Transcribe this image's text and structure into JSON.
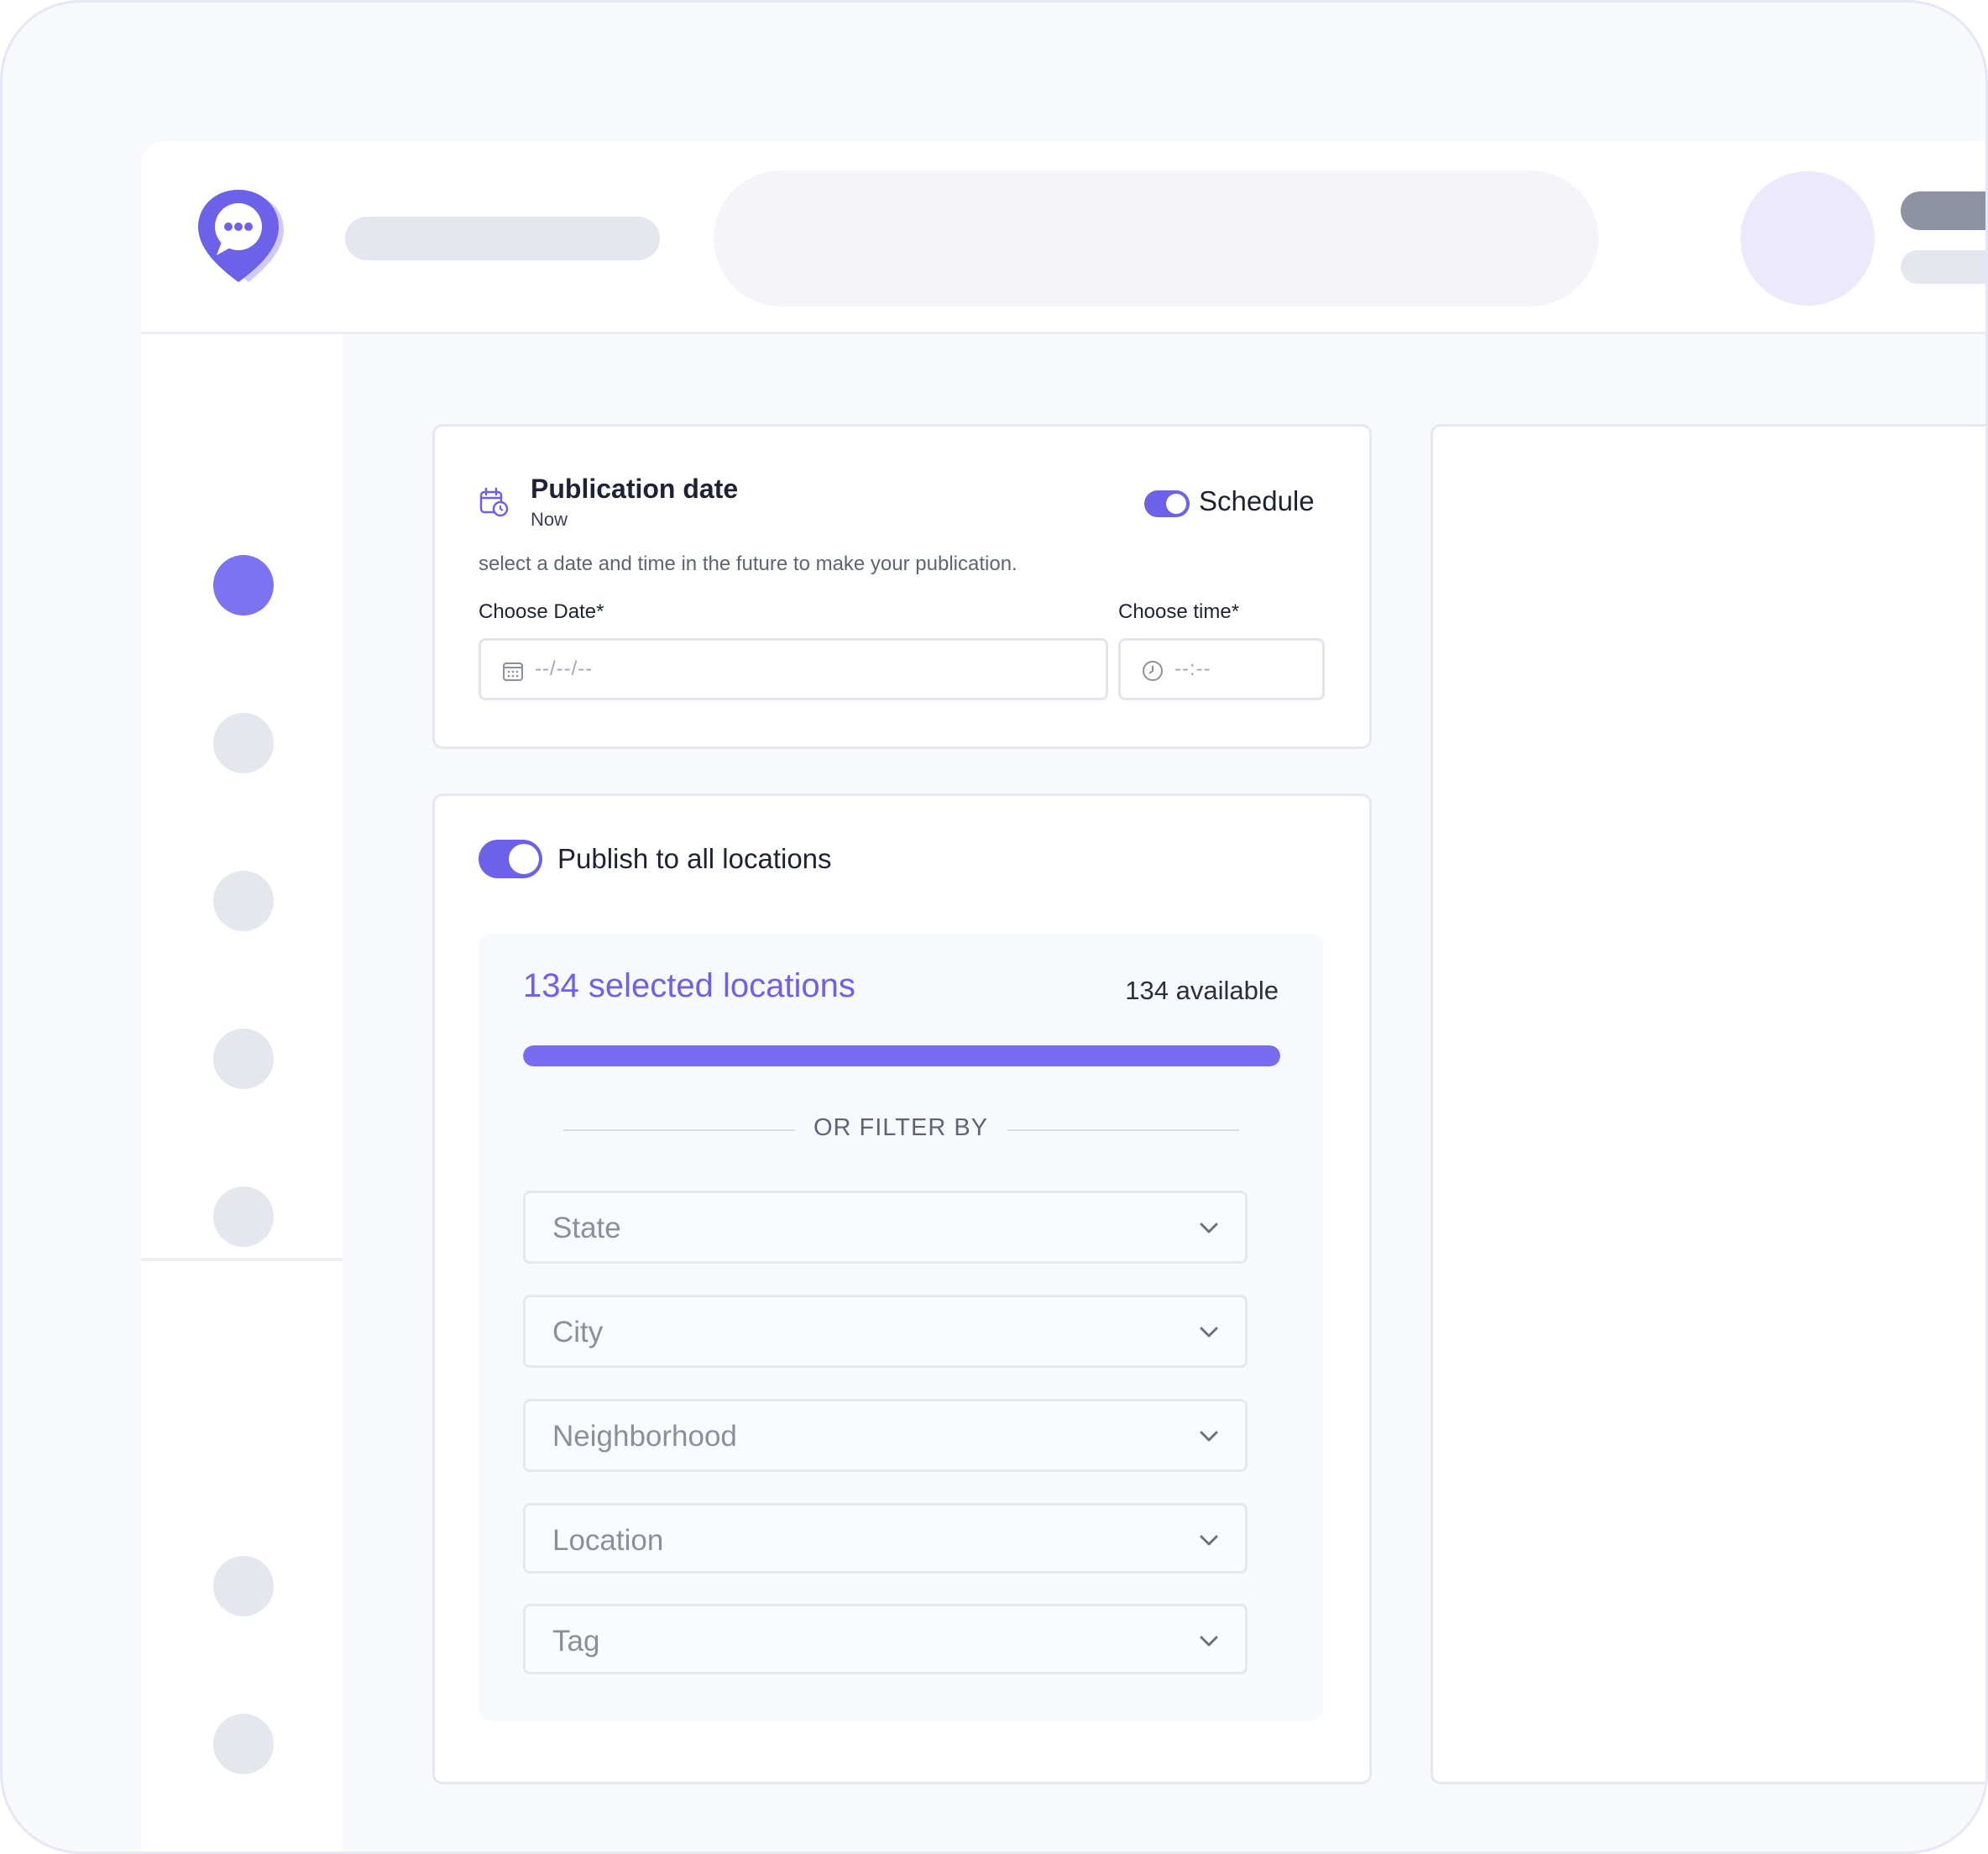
{
  "colors": {
    "accent": "#6c61e8",
    "accent_light": "#7c72f2",
    "placeholder_gray": "#e5e7ee",
    "background": "#f8f9fc"
  },
  "icons": {
    "logo": "chat-location-pin-icon",
    "calendar": "calendar-clock-icon",
    "date_field": "calendar-icon",
    "time_field": "clock-icon",
    "dropdown": "chevron-down-icon"
  },
  "publication": {
    "title": "Publication date",
    "subtitle": "Now",
    "schedule_label": "Schedule",
    "schedule_on": true,
    "hint": "select a date and time in the future to make your publication.",
    "date_label": "Choose Date*",
    "date_placeholder": "--/--/--",
    "time_label": "Choose time*",
    "time_placeholder": "--:--"
  },
  "locations": {
    "publish_all_label": "Publish to all locations",
    "publish_all_on": true,
    "selected_text": "134 selected locations",
    "available_text": "134 available",
    "progress_fraction": 1.0,
    "filter_divider": "OR FILTER BY",
    "filters": [
      {
        "label": "State"
      },
      {
        "label": "City"
      },
      {
        "label": "Neighborhood"
      },
      {
        "label": "Location"
      },
      {
        "label": "Tag"
      }
    ]
  }
}
